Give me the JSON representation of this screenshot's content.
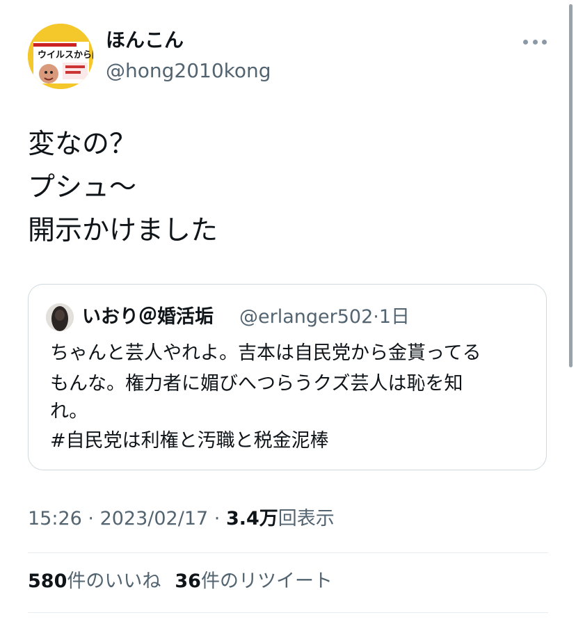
{
  "tweet": {
    "author_name": "ほんこん",
    "author_handle": "@hong2010kong",
    "avatar_text": "ウイルスから国民を守るのも国防や！",
    "text_lines": [
      "変なの？",
      "プシュ〜",
      "開示かけました"
    ]
  },
  "quote": {
    "author_name": "いおり＠婚活垢",
    "author_handle": "@erlanger502",
    "separator": "·",
    "time_ago": "1日",
    "text_lines": [
      "ちゃんと芸人やれよ。吉本は自民党から金貰ってる",
      "もんな。権力者に媚びへつらうクズ芸人は恥を知",
      "れ。",
      "#自民党は利権と汚職と税金泥棒"
    ]
  },
  "meta": {
    "time": "15:26",
    "sep1": " · ",
    "date": "2023/02/17",
    "sep2": " · ",
    "views_value": "3.4万",
    "views_label": "回表示"
  },
  "stats": {
    "likes_value": "580",
    "likes_label": "件のいいね",
    "retweets_value": "36",
    "retweets_label": "件のリツイート"
  },
  "colors": {
    "text": "#0f1419",
    "secondary": "#536471",
    "border": "#cfd9de",
    "divider": "#e6ecf0"
  },
  "icons": {
    "more": "more-dots-icon"
  }
}
